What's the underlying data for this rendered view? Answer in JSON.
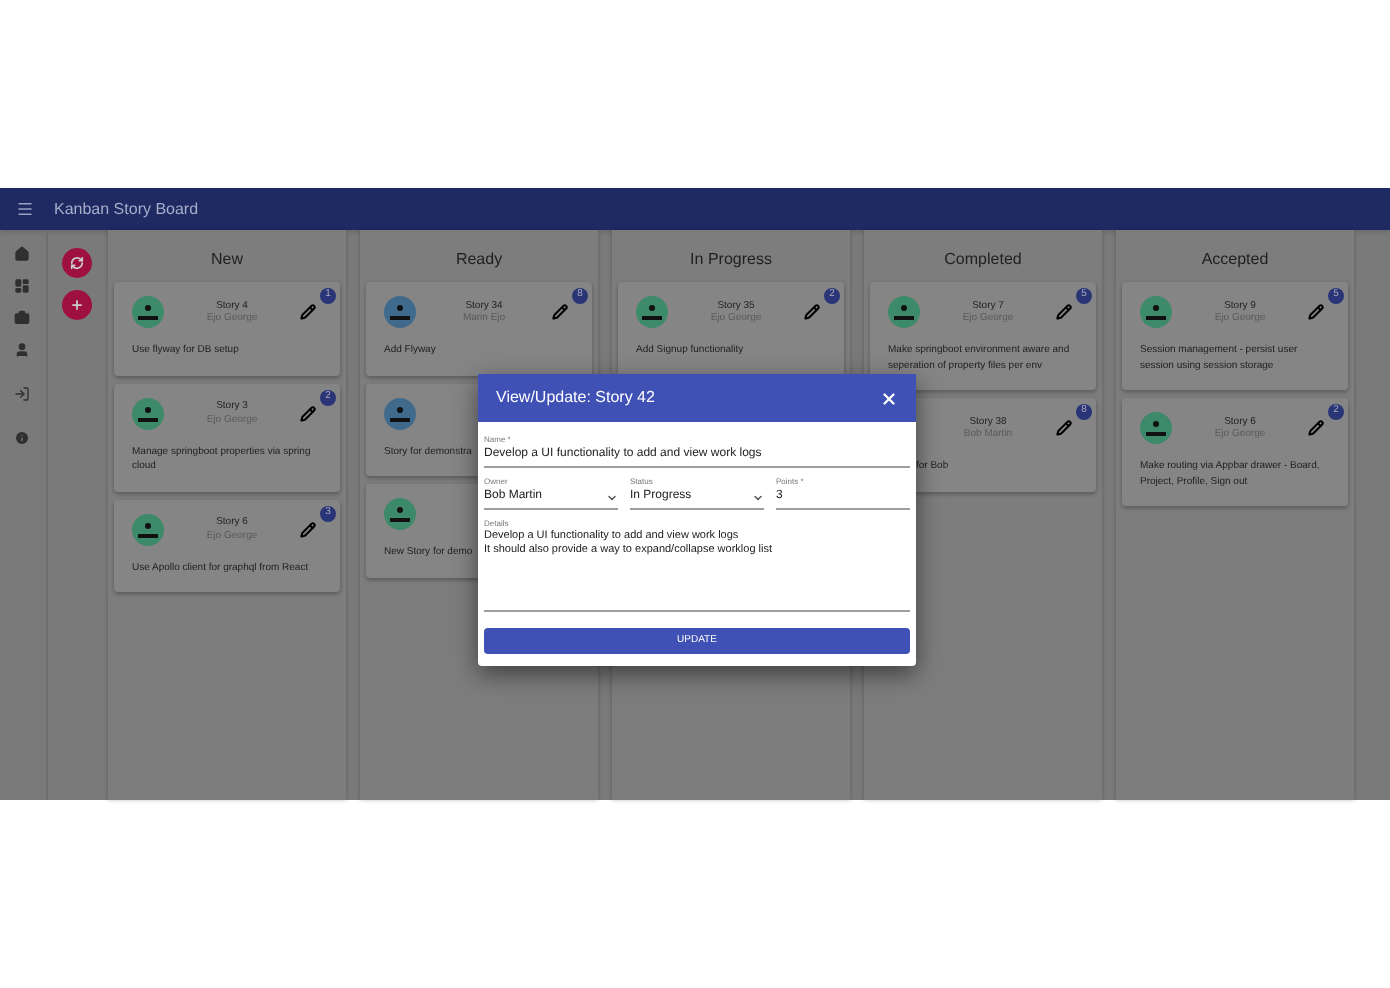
{
  "app_bar": {
    "title": "Kanban Story Board"
  },
  "columns": [
    {
      "title": "New",
      "cards": [
        {
          "kind": "full",
          "color": "#3d8a6a",
          "title": "Story 4",
          "owner": "Ejo George",
          "badge": "1",
          "description": "Use flyway for DB setup"
        },
        {
          "kind": "full",
          "color": "#3d8a6a",
          "title": "Story 3",
          "owner": "Ejo George",
          "badge": "2",
          "description": "Manage springboot properties via spring cloud"
        },
        {
          "kind": "full",
          "color": "#3d8a6a",
          "title": "Story 6",
          "owner": "Ejo George",
          "badge": "3",
          "description": "Use Apollo client for graphql from React"
        }
      ]
    },
    {
      "title": "Ready",
      "cards": [
        {
          "kind": "full",
          "color": "#3f6a8c",
          "title": "Story 34",
          "owner": "Marin Ejo",
          "badge": "8",
          "description": "Add Flyway"
        },
        {
          "kind": "right-covered",
          "color": "#3f6a8c",
          "description": "Story for demonstra"
        },
        {
          "kind": "right-covered",
          "color": "#3d8a6a",
          "description": "New Story for demo"
        }
      ]
    },
    {
      "title": "In Progress",
      "cards": [
        {
          "kind": "full",
          "color": "#3d8a6a",
          "title": "Story 35",
          "owner": "Ejo George",
          "badge": "2",
          "description": "Add Signup functionality"
        }
      ]
    },
    {
      "title": "Completed",
      "cards": [
        {
          "kind": "full",
          "color": "#3d8a6a",
          "title": "Story 7",
          "owner": "Ejo George",
          "badge": "5",
          "description": "Make springboot environment aware and seperation of property files per env"
        },
        {
          "kind": "left-covered",
          "title": "Story 38",
          "owner": "Bob Martin",
          "badge": "8",
          "description": "for Bob"
        }
      ]
    },
    {
      "title": "Accepted",
      "cards": [
        {
          "kind": "full",
          "color": "#3d8a6a",
          "title": "Story 9",
          "owner": "Ejo George",
          "badge": "5",
          "description": "Session management - persist user session using session storage"
        },
        {
          "kind": "full",
          "color": "#3d8a6a",
          "title": "Story 6",
          "owner": "Ejo George",
          "badge": "2",
          "description": "Make routing via Appbar drawer - Board, Project, Profile, Sign out"
        }
      ]
    }
  ],
  "dialog": {
    "title": "View/Update: Story 42",
    "name": {
      "label": "Name *",
      "value": "Develop a UI functionality to add and view work logs"
    },
    "owner": {
      "label": "Owner",
      "value": "Bob Martin"
    },
    "status": {
      "label": "Status",
      "value": "In Progress"
    },
    "points": {
      "label": "Points *",
      "value": "3"
    },
    "details": {
      "label": "Details",
      "lines": [
        "Develop a UI functionality to add and view work logs",
        "It should also provide a way to expand/collapse worklog list"
      ]
    },
    "button": "UPDATE"
  }
}
